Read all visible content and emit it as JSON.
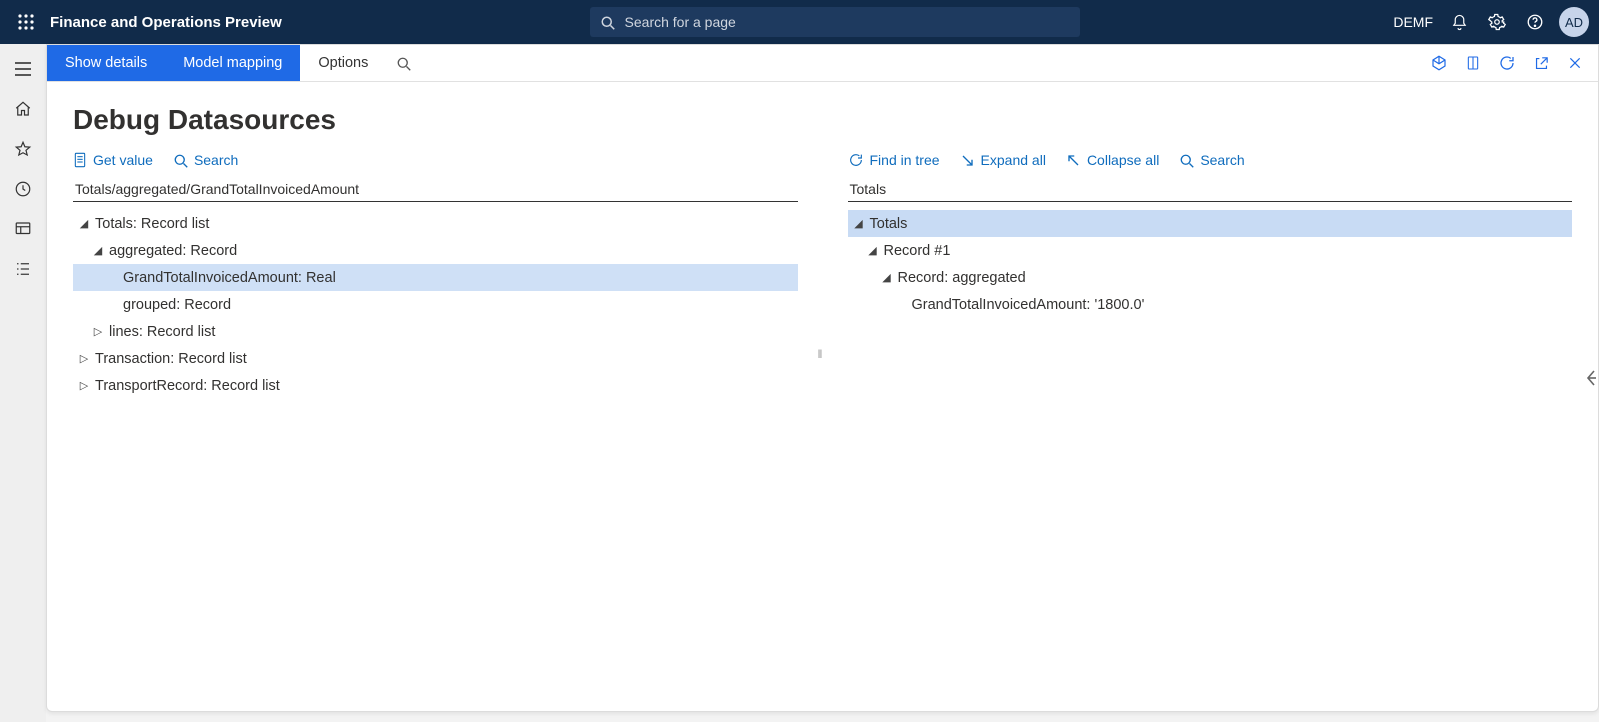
{
  "header": {
    "app_title": "Finance and Operations Preview",
    "search_placeholder": "Search for a page",
    "company_code": "DEMF",
    "user_initials": "AD"
  },
  "commandbar": {
    "tabs": {
      "show_details": "Show details",
      "model_mapping": "Model mapping",
      "options": "Options"
    }
  },
  "page_title": "Debug Datasources",
  "left_toolbar": {
    "get_value": "Get value",
    "search": "Search"
  },
  "right_toolbar": {
    "find_in_tree": "Find in tree",
    "expand_all": "Expand all",
    "collapse_all": "Collapse all",
    "search": "Search"
  },
  "left_path": "Totals/aggregated/GrandTotalInvoicedAmount",
  "right_path": "Totals",
  "left_tree": {
    "n0": "Totals: Record list",
    "n1": "aggregated: Record",
    "n2": "GrandTotalInvoicedAmount: Real",
    "n3": "grouped: Record",
    "n4": "lines: Record list",
    "n5": "Transaction: Record list",
    "n6": "TransportRecord: Record list"
  },
  "right_tree": {
    "n0": "Totals",
    "n1": "Record #1",
    "n2": "Record: aggregated",
    "n3": "GrandTotalInvoicedAmount: '1800.0'"
  }
}
